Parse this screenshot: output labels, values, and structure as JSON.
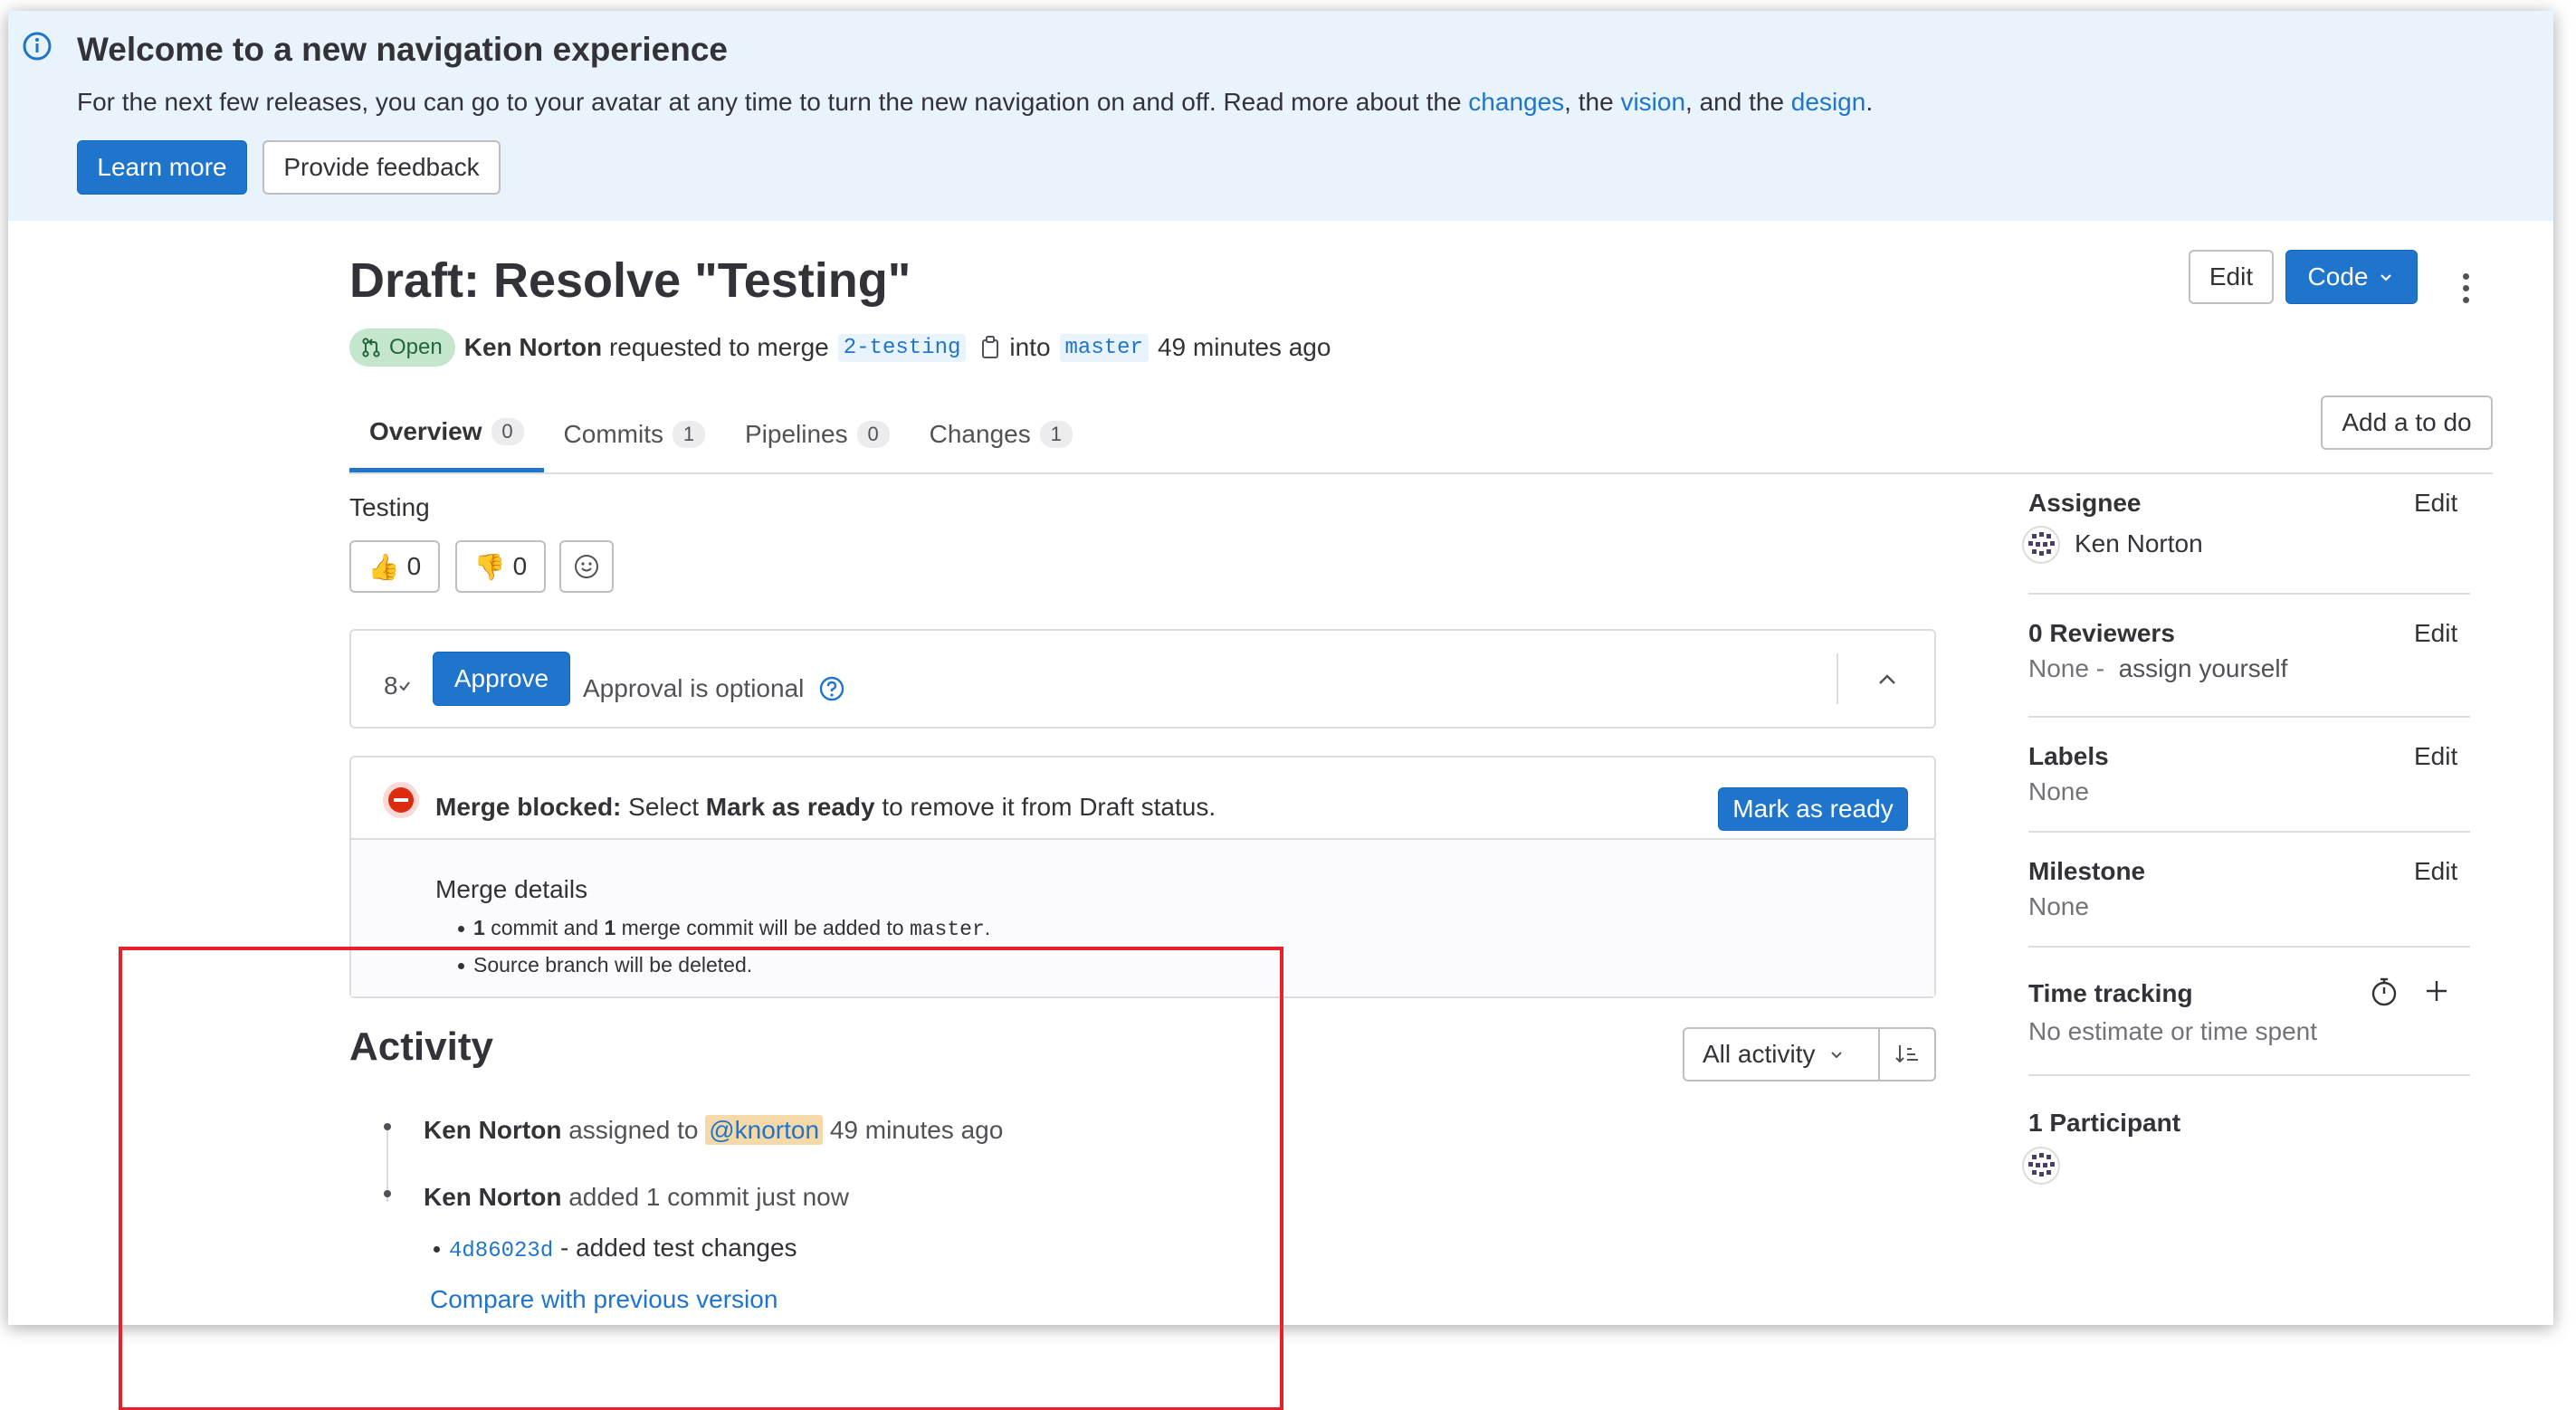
{
  "banner": {
    "title": "Welcome to a new navigation experience",
    "text_before": "For the next few releases, you can go to your avatar at any time to turn the new navigation on and off. Read more about the ",
    "link_changes": "changes",
    "text_sep1": ", the ",
    "link_vision": "vision",
    "text_sep2": ", and the ",
    "link_design": "design",
    "text_end": ".",
    "learn_more": "Learn more",
    "provide_feedback": "Provide feedback"
  },
  "header": {
    "title": "Draft: Resolve \"Testing\"",
    "status": "Open",
    "author": "Ken Norton",
    "requested_text": "requested to merge",
    "source_branch": "2-testing",
    "into_text": "into",
    "target_branch": "master",
    "time": "49 minutes ago",
    "edit_button": "Edit",
    "code_button": "Code"
  },
  "tabs": [
    {
      "label": "Overview",
      "count": "0"
    },
    {
      "label": "Commits",
      "count": "1"
    },
    {
      "label": "Pipelines",
      "count": "0"
    },
    {
      "label": "Changes",
      "count": "1"
    }
  ],
  "add_todo": "Add a to do",
  "description": "Testing",
  "reactions": {
    "thumbsup": "0",
    "thumbsdown": "0"
  },
  "approval": {
    "approvals_icon_text": "8",
    "approve_button": "Approve",
    "optional_text": "Approval is optional"
  },
  "merge": {
    "blocked_label": "Merge blocked:",
    "blocked_text1": "Select",
    "blocked_bold": "Mark as ready",
    "blocked_text2": "to remove it from Draft status.",
    "mark_ready_button": "Mark as ready",
    "details_title": "Merge details",
    "detail_1_n1": "1",
    "detail_1_a": "commit and",
    "detail_1_n2": "1",
    "detail_1_b": "merge commit will be added to",
    "detail_1_branch": "master",
    "detail_1_end": ".",
    "detail_2": "Source branch will be deleted."
  },
  "activity": {
    "title": "Activity",
    "filter": "All activity",
    "items": [
      {
        "author": "Ken Norton",
        "action": "assigned to",
        "mention": "@knorton",
        "time": "49 minutes ago"
      },
      {
        "author": "Ken Norton",
        "action": "added 1 commit just now"
      }
    ],
    "commit_sha": "4d86023d",
    "commit_message": "- added test changes",
    "compare_link": "Compare with previous version"
  },
  "sidebar": {
    "assignee_title": "Assignee",
    "assignee_name": "Ken Norton",
    "reviewers_title": "0 Reviewers",
    "reviewers_none": "None -",
    "assign_yourself": "assign yourself",
    "labels_title": "Labels",
    "labels_value": "None",
    "milestone_title": "Milestone",
    "milestone_value": "None",
    "time_title": "Time tracking",
    "time_value": "No estimate or time spent",
    "participants_title": "1 Participant",
    "edit_label": "Edit"
  }
}
